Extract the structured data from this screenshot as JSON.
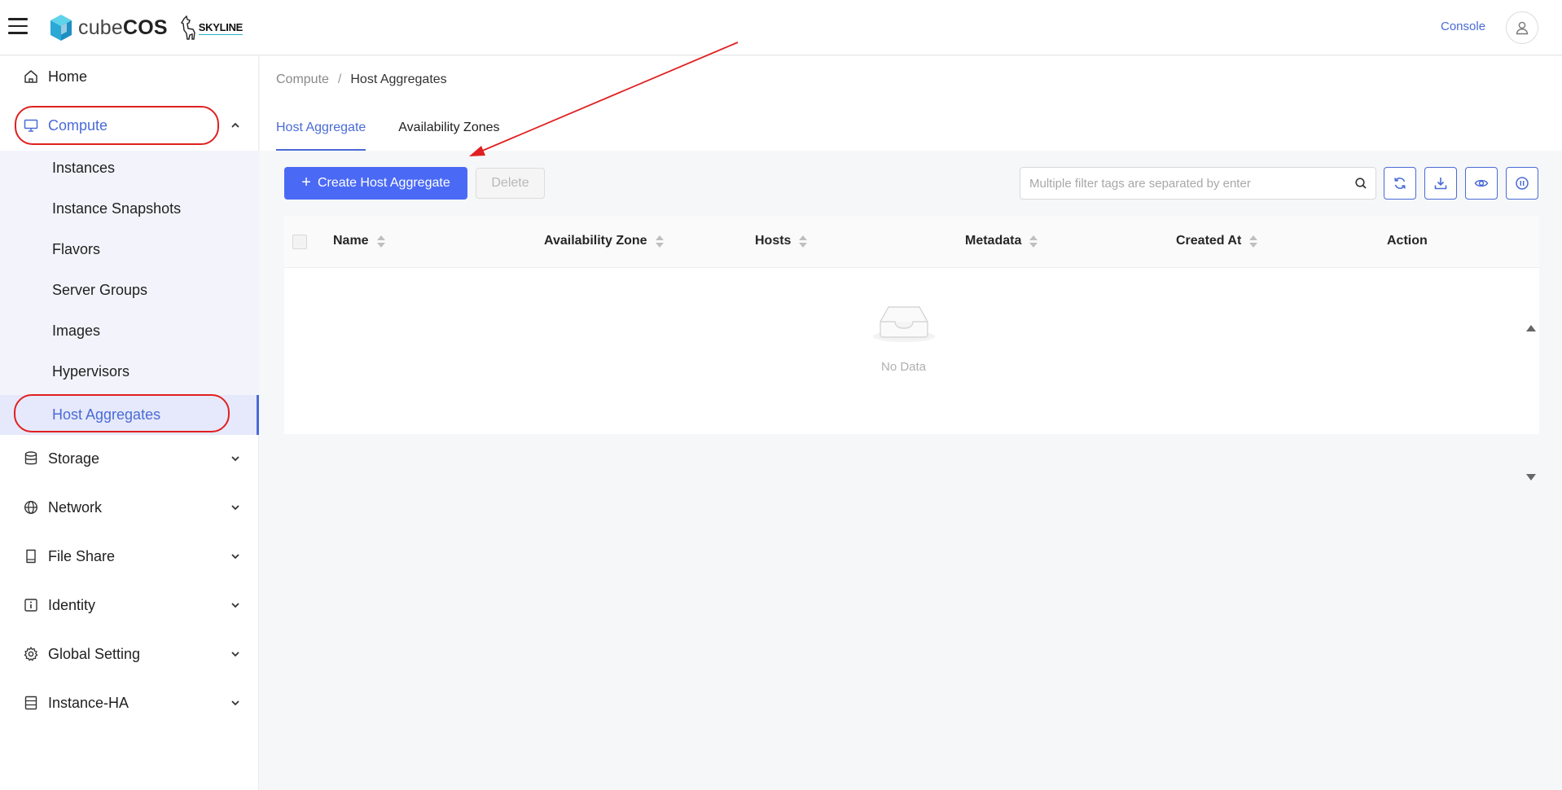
{
  "header": {
    "logo_prefix": "cube",
    "logo_suffix": "COS",
    "partner_logo": "SKYLINE",
    "console_label": "Console",
    "icons": {
      "menu": "hamburger-icon",
      "user": "user-icon"
    }
  },
  "sidebar": {
    "items": [
      {
        "label": "Home",
        "icon": "home-icon"
      },
      {
        "label": "Compute",
        "icon": "monitor-icon",
        "expanded": true
      },
      {
        "label": "Storage",
        "icon": "database-icon"
      },
      {
        "label": "Network",
        "icon": "globe-icon"
      },
      {
        "label": "File Share",
        "icon": "file-icon"
      },
      {
        "label": "Identity",
        "icon": "info-icon"
      },
      {
        "label": "Global Setting",
        "icon": "gear-icon"
      },
      {
        "label": "Instance-HA",
        "icon": "server-icon"
      }
    ],
    "compute_children": [
      {
        "label": "Instances"
      },
      {
        "label": "Instance Snapshots"
      },
      {
        "label": "Flavors"
      },
      {
        "label": "Server Groups"
      },
      {
        "label": "Images"
      },
      {
        "label": "Hypervisors"
      },
      {
        "label": "Host Aggregates",
        "selected": true
      }
    ]
  },
  "breadcrumb": {
    "parent": "Compute",
    "separator": "/",
    "current": "Host Aggregates"
  },
  "tabs": [
    {
      "label": "Host Aggregate",
      "active": true
    },
    {
      "label": "Availability Zones",
      "active": false
    }
  ],
  "toolbar": {
    "create_label": "Create Host Aggregate",
    "delete_label": "Delete",
    "search_placeholder": "Multiple filter tags are separated by enter",
    "icon_buttons": [
      "refresh-icon",
      "download-icon",
      "eye-icon",
      "pause-icon"
    ]
  },
  "table": {
    "columns": [
      "Name",
      "Availability Zone",
      "Hosts",
      "Metadata",
      "Created At",
      "Action"
    ],
    "rows": [],
    "empty_text": "No Data"
  },
  "colors": {
    "accent": "#4a6bd6",
    "primary_button": "#4a6af5",
    "annotation": "#e02020"
  }
}
